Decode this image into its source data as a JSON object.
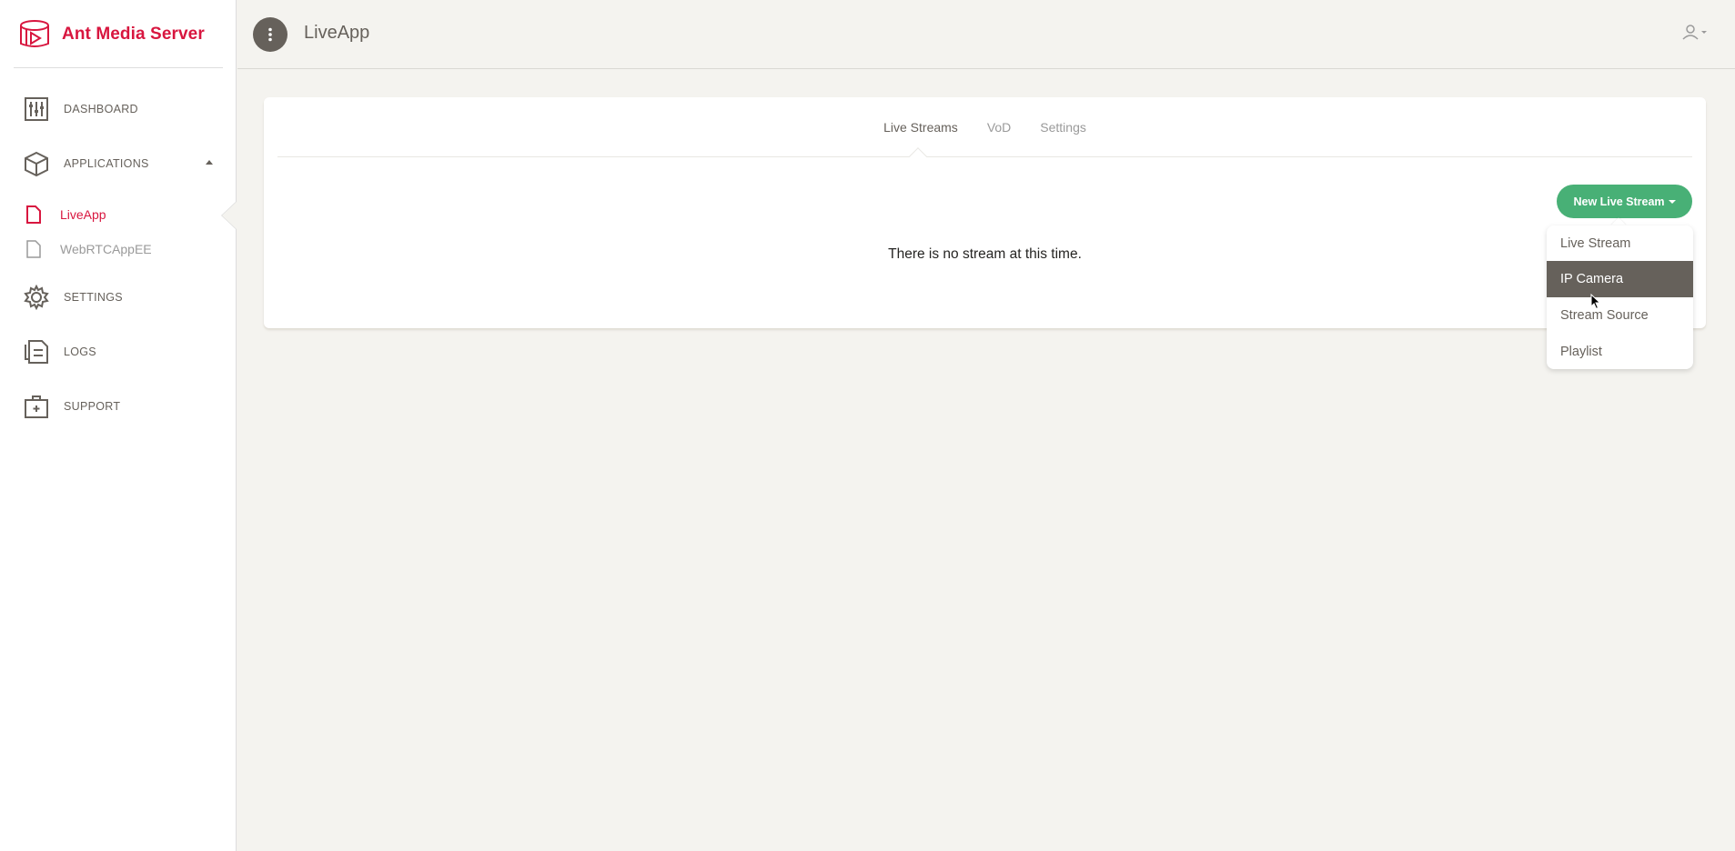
{
  "brand": {
    "name": "Ant Media Server",
    "accent": "#d8163f"
  },
  "sidebar": {
    "items": [
      {
        "label": "DASHBOARD",
        "icon": "dashboard-icon"
      },
      {
        "label": "APPLICATIONS",
        "icon": "box-icon"
      },
      {
        "label": "SETTINGS",
        "icon": "gear-icon"
      },
      {
        "label": "LOGS",
        "icon": "logs-icon"
      },
      {
        "label": "SUPPORT",
        "icon": "support-icon"
      }
    ],
    "apps": [
      {
        "label": "LiveApp",
        "active": true,
        "icon": "file-icon"
      },
      {
        "label": "WebRTCAppEE",
        "active": false,
        "icon": "file-icon"
      }
    ]
  },
  "header": {
    "title": "LiveApp",
    "menu_icon": "more-vertical-icon",
    "user_icon": "user-icon"
  },
  "tabs": [
    {
      "label": "Live Streams",
      "active": true
    },
    {
      "label": "VoD",
      "active": false
    },
    {
      "label": "Settings",
      "active": false
    }
  ],
  "actions": {
    "new_stream_label": "New Live Stream",
    "button_color": "#48b076"
  },
  "empty_state": "There is no stream at this time.",
  "dropdown": {
    "items": [
      {
        "label": "Live Stream",
        "highlighted": false
      },
      {
        "label": "IP Camera",
        "highlighted": true
      },
      {
        "label": "Stream Source",
        "highlighted": false
      },
      {
        "label": "Playlist",
        "highlighted": false
      }
    ]
  }
}
